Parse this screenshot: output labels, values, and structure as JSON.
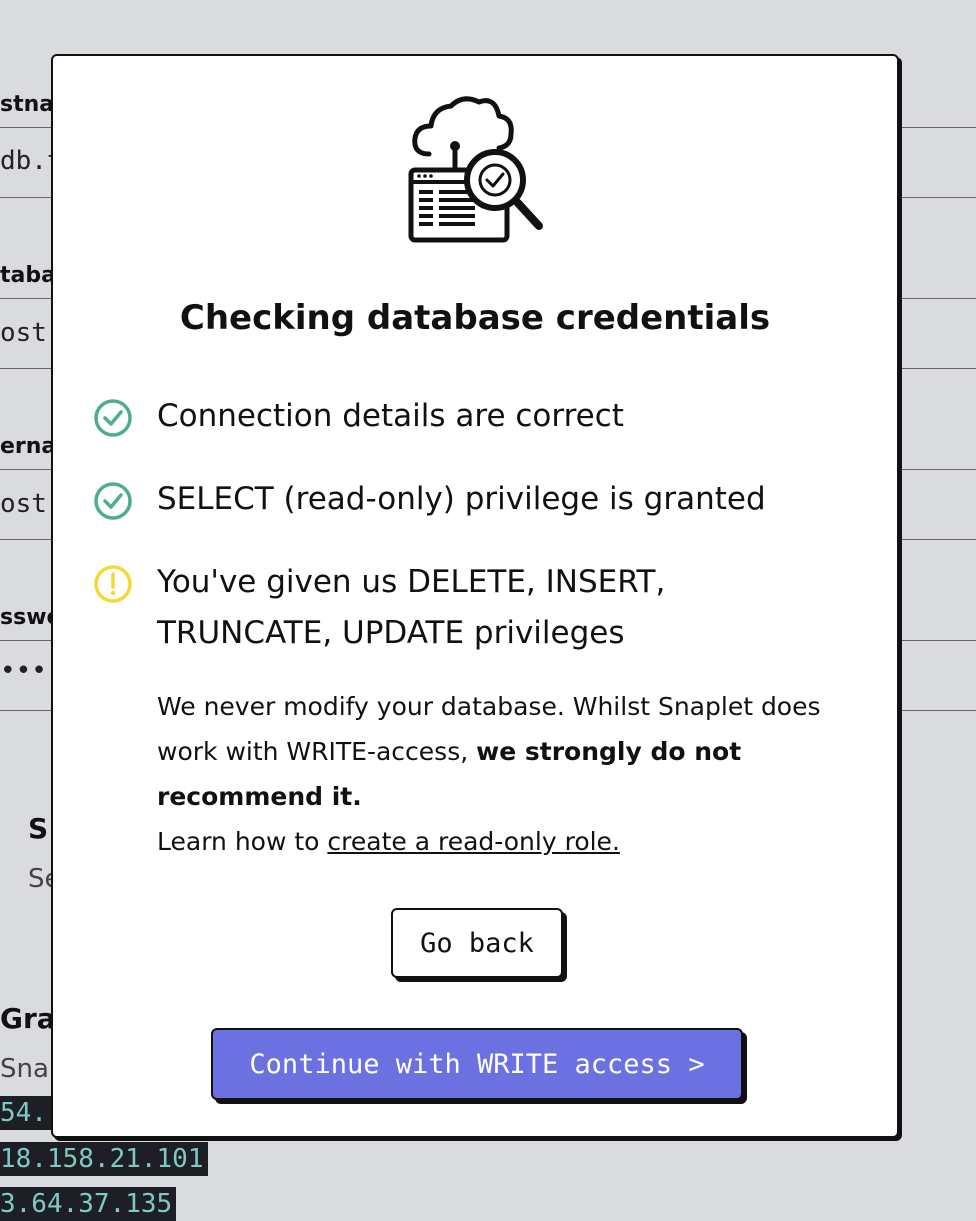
{
  "background": {
    "fields": [
      {
        "label": "stna",
        "value": "db.t"
      },
      {
        "label": "taba",
        "value": "ost"
      },
      {
        "label": "erna",
        "value": "ost"
      },
      {
        "label": "sswo",
        "value": "••••"
      }
    ],
    "section": {
      "heading": "S",
      "sub": "Se"
    },
    "grant": {
      "heading": "Gra",
      "sub": "Snap"
    },
    "ips": [
      "54.",
      "18.158.21.101",
      "3.64.37.135"
    ]
  },
  "modal": {
    "illustration_icon": "cloud-database-search-icon",
    "title": "Checking database credentials",
    "checks": [
      {
        "status": "success",
        "icon": "check-circle-icon",
        "text": "Connection details are correct"
      },
      {
        "status": "success",
        "icon": "check-circle-icon",
        "text": "SELECT (read-only) privilege is granted"
      },
      {
        "status": "warning",
        "icon": "warning-circle-icon",
        "text": "You've given us DELETE, INSERT, TRUNCATE, UPDATE privileges"
      }
    ],
    "description": {
      "text_1": "We never modify your database. Whilst Snaplet does work with WRITE-access, ",
      "strong": "we strongly do not recommend it.",
      "learn_prefix": "Learn how to ",
      "learn_link": "create a read-only role."
    },
    "go_back_label": "Go back",
    "continue_label": "Continue with WRITE access >"
  },
  "colors": {
    "success": "#4caf8a",
    "warning": "#f2d935",
    "accent": "#6b71e0"
  }
}
